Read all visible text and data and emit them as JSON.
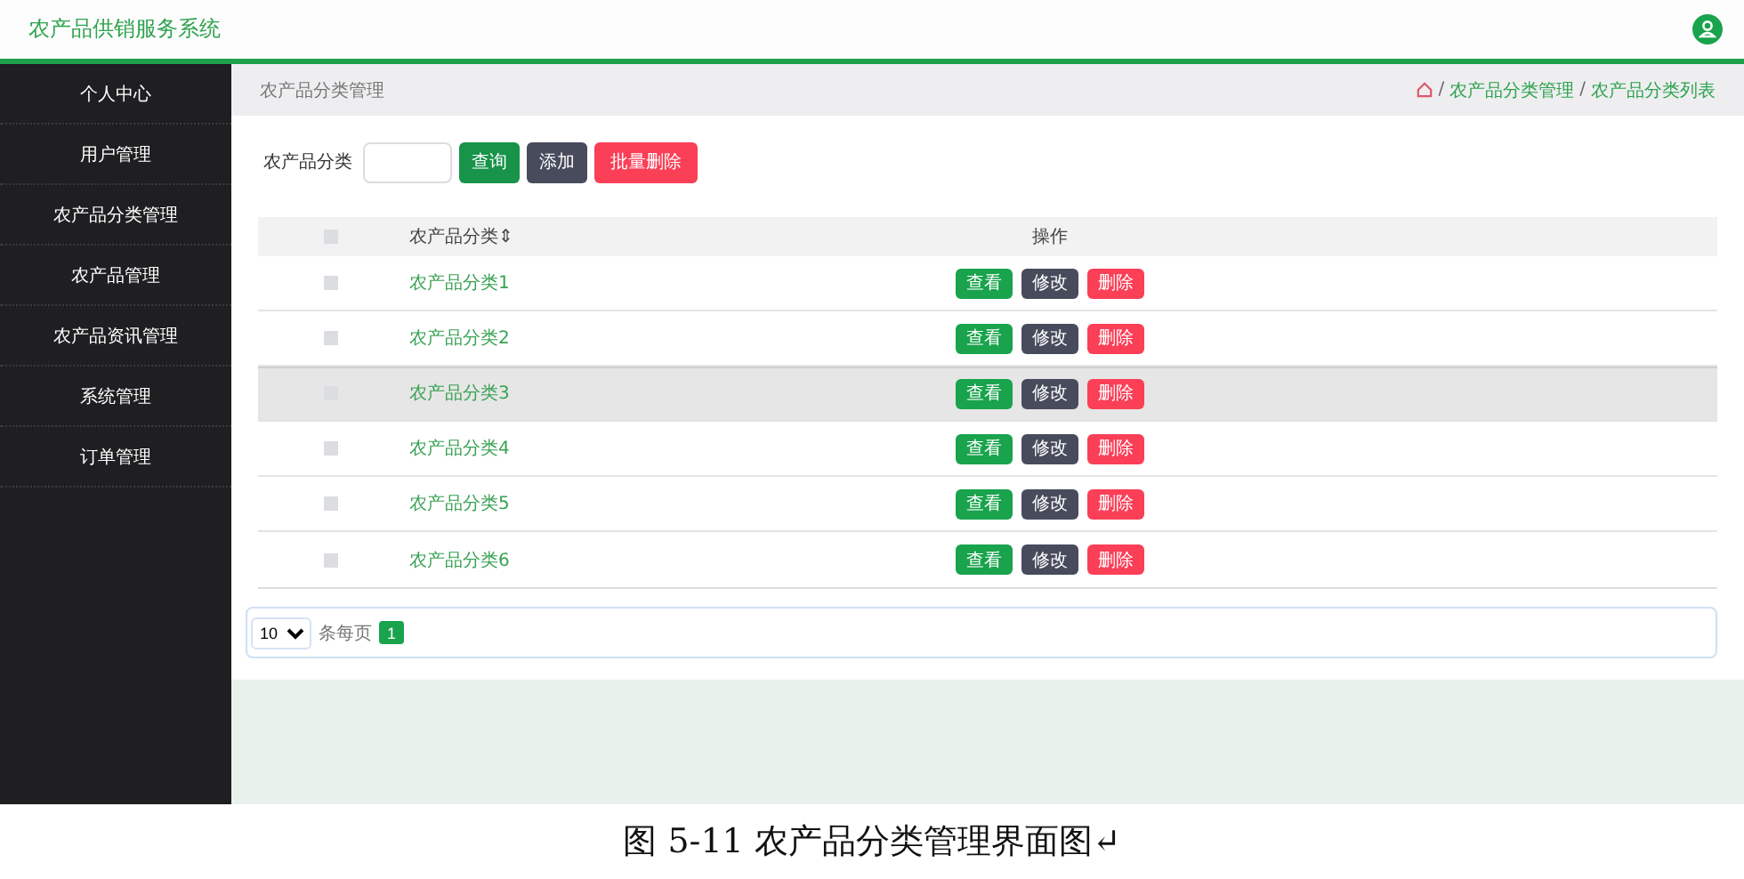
{
  "header": {
    "title": "农产品供销服务系统"
  },
  "sidebar": {
    "items": [
      {
        "label": "个人中心"
      },
      {
        "label": "用户管理"
      },
      {
        "label": "农产品分类管理"
      },
      {
        "label": "农产品管理"
      },
      {
        "label": "农产品资讯管理"
      },
      {
        "label": "系统管理"
      },
      {
        "label": "订单管理"
      }
    ]
  },
  "page_header": {
    "title": "农产品分类管理",
    "breadcrumb": [
      "农产品分类管理",
      "农产品分类列表"
    ],
    "breadcrumb_separator": "/"
  },
  "filter": {
    "label": "农产品分类",
    "buttons": [
      {
        "label": "查询",
        "kind": "search"
      },
      {
        "label": "添加",
        "kind": "add"
      },
      {
        "label": "批量删除",
        "kind": "delete"
      }
    ]
  },
  "table": {
    "columns": [
      "农产品分类⇕",
      "操作"
    ],
    "header_checked": false,
    "rows": [
      {
        "name": "农产品分类1",
        "checked": false,
        "hovered": false,
        "actions": [
          {
            "label": "查看",
            "kind": "view"
          },
          {
            "label": "修改",
            "kind": "edit"
          },
          {
            "label": "删除",
            "kind": "delete"
          }
        ]
      },
      {
        "name": "农产品分类2",
        "checked": false,
        "hovered": false,
        "actions": [
          {
            "label": "查看",
            "kind": "view"
          },
          {
            "label": "修改",
            "kind": "edit"
          },
          {
            "label": "删除",
            "kind": "delete"
          }
        ]
      },
      {
        "name": "农产品分类3",
        "checked": false,
        "hovered": true,
        "actions": [
          {
            "label": "查看",
            "kind": "view"
          },
          {
            "label": "修改",
            "kind": "edit"
          },
          {
            "label": "删除",
            "kind": "delete"
          }
        ]
      },
      {
        "name": "农产品分类4",
        "checked": false,
        "hovered": false,
        "actions": [
          {
            "label": "查看",
            "kind": "view"
          },
          {
            "label": "修改",
            "kind": "edit"
          },
          {
            "label": "删除",
            "kind": "delete"
          }
        ]
      },
      {
        "name": "农产品分类5",
        "checked": false,
        "hovered": false,
        "actions": [
          {
            "label": "查看",
            "kind": "view"
          },
          {
            "label": "修改",
            "kind": "edit"
          },
          {
            "label": "删除",
            "kind": "delete"
          }
        ]
      },
      {
        "name": "农产品分类6",
        "checked": false,
        "hovered": false,
        "actions": [
          {
            "label": "查看",
            "kind": "view"
          },
          {
            "label": "修改",
            "kind": "edit"
          },
          {
            "label": "删除",
            "kind": "delete"
          }
        ]
      }
    ]
  },
  "pagination": {
    "page_size": "10",
    "page_size_label": "条每页",
    "pages": [
      {
        "label": "1",
        "selected": true
      }
    ]
  },
  "caption": "图 5-11 农产品分类管理界面图↵"
}
